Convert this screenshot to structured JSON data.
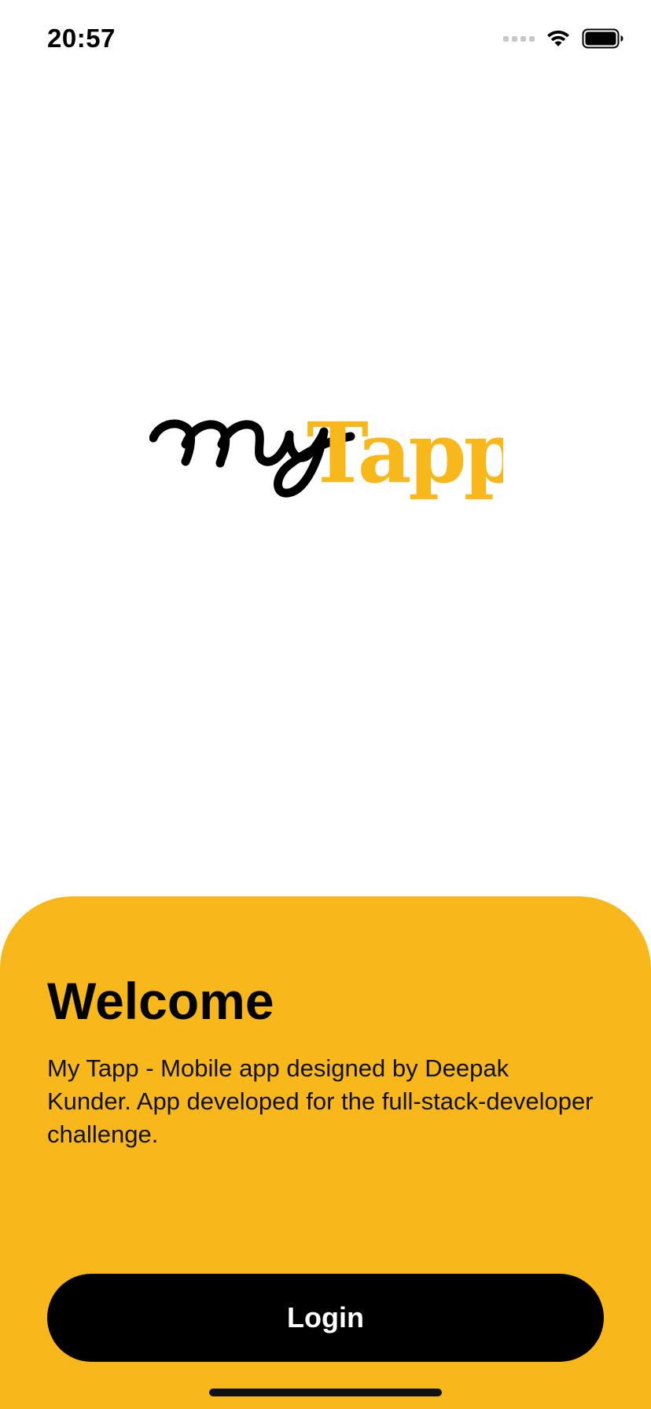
{
  "status_bar": {
    "time": "20:57",
    "icons": [
      "signal-dots-icon",
      "wifi-icon",
      "battery-icon"
    ]
  },
  "logo": {
    "text_script": "my",
    "text_serif": "Tapp",
    "colors": {
      "script": "#000000",
      "serif": "#f8b71b"
    }
  },
  "welcome": {
    "title": "Welcome",
    "description": "My Tapp - Mobile app designed by Deepak Kunder. App developed for the full-stack-developer challenge."
  },
  "actions": {
    "login_label": "Login"
  },
  "colors": {
    "accent": "#f8b71b",
    "button_bg": "#000000",
    "button_text": "#ffffff",
    "background": "#ffffff"
  }
}
